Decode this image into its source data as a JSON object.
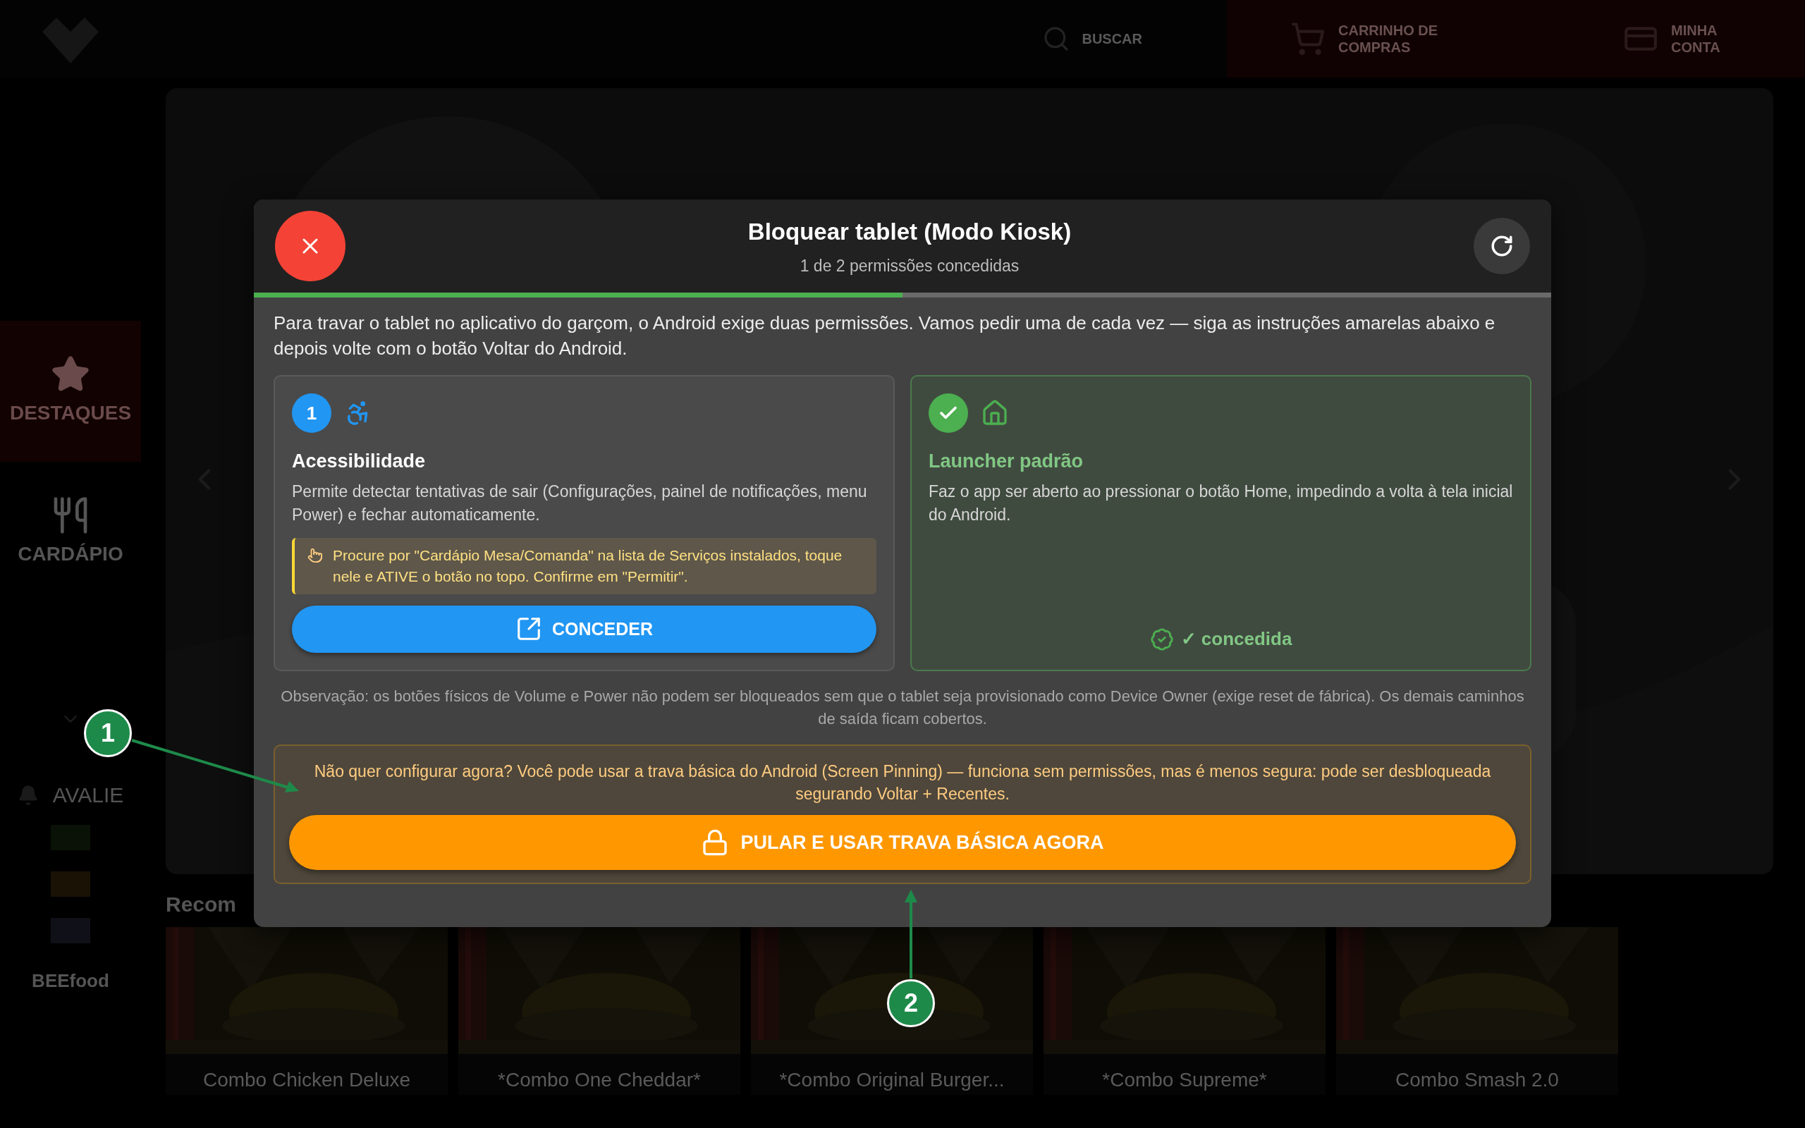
{
  "app_header": {
    "search_label": "BUSCAR",
    "cart_label": "CARRINHO DE COMPRAS",
    "account_label": "MINHA CONTA"
  },
  "sidebar": {
    "items": [
      {
        "label": "DESTAQUES",
        "selected": true,
        "kind": "star"
      },
      {
        "label": "CARDÁPIO",
        "selected": false,
        "kind": "cutlery"
      }
    ],
    "rate_label": "AVALIE",
    "brand": "BEEfood"
  },
  "recommended": {
    "title": "Recom",
    "products": [
      {
        "name": "Combo Chicken Deluxe"
      },
      {
        "name": "*Combo One Cheddar*"
      },
      {
        "name": "*Combo Original Burger..."
      },
      {
        "name": "*Combo Supreme*"
      },
      {
        "name": "Combo Smash 2.0"
      }
    ]
  },
  "dialog": {
    "title": "Bloquear tablet (Modo Kiosk)",
    "subtitle": "1 de 2 permissões concedidas",
    "progress": {
      "level": 0.5
    },
    "intro": "Para travar o tablet no aplicativo do garçom, o Android exige duas permissões. Vamos pedir uma de cada vez — siga as instruções amarelas abaixo e depois volte com o botão Voltar do Android.",
    "permissions": [
      {
        "kind": "accessibility",
        "number": "1",
        "title": "Acessibilidade",
        "description": "Permite detectar tentativas de sair (Configurações, painel de notificações, menu Power) e fechar automaticamente.",
        "granted": false,
        "hint": "Procure por \"Cardápio Mesa/Comanda\" na lista de Serviços instalados, toque nele e ATIVE o botão no topo. Confirme em \"Permitir\".",
        "button": "CONCEDER"
      },
      {
        "kind": "home",
        "title": "Launcher padrão",
        "description": "Faz o app ser aberto ao pressionar o botão Home, impedindo a volta à tela inicial do Android.",
        "granted": true,
        "status": "✓ concedida"
      }
    ],
    "note": "Observação: os botões físicos de Volume e Power não podem ser bloqueados sem que o tablet seja provisionado como Device Owner (exige reset de fábrica). Os demais caminhos de saída ficam cobertos.",
    "fallback": {
      "text": "Não quer configurar agora? Você pode usar a trava básica do Android (Screen Pinning) — funciona sem permissões, mas é menos segura: pode ser desbloqueada segurando Voltar + Recentes.",
      "button": "PULAR E USAR TRAVA BÁSICA AGORA"
    }
  },
  "annotations": [
    {
      "label": "1"
    },
    {
      "label": "2"
    }
  ]
}
